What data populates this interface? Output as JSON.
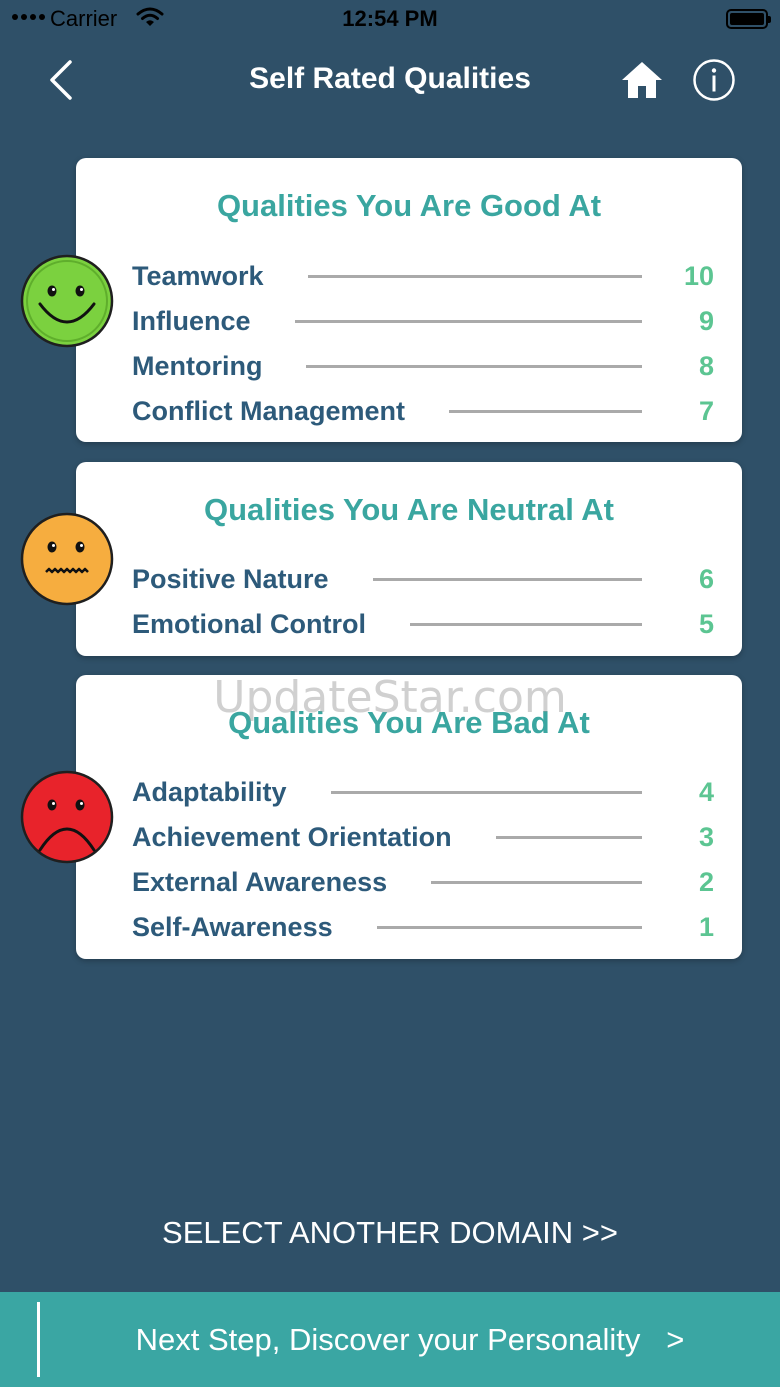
{
  "status_bar": {
    "carrier": "Carrier",
    "time": "12:54 PM"
  },
  "nav": {
    "title": "Self Rated Qualities",
    "back_icon": "chevron-left-icon",
    "home_icon": "home-icon",
    "info_icon": "info-icon"
  },
  "sections": [
    {
      "title": "Qualities You Are Good At",
      "face": "happy-face-icon",
      "face_color": "#7bd13f",
      "items": [
        {
          "label": "Teamwork",
          "score": "10"
        },
        {
          "label": "Influence",
          "score": "9"
        },
        {
          "label": "Mentoring",
          "score": "8"
        },
        {
          "label": "Conflict Management",
          "score": "7"
        }
      ]
    },
    {
      "title": "Qualities You Are Neutral At",
      "face": "neutral-face-icon",
      "face_color": "#f6ad3f",
      "items": [
        {
          "label": "Positive Nature",
          "score": "6"
        },
        {
          "label": "Emotional Control",
          "score": "5"
        }
      ]
    },
    {
      "title": "Qualities You Are Bad At",
      "face": "sad-face-icon",
      "face_color": "#e8232b",
      "items": [
        {
          "label": "Adaptability",
          "score": "4"
        },
        {
          "label": "Achievement Orientation",
          "score": "3"
        },
        {
          "label": "External Awareness",
          "score": "2"
        },
        {
          "label": "Self-Awareness",
          "score": "1"
        }
      ]
    }
  ],
  "watermark": "UpdateStar.com",
  "select_domain": "SELECT ANOTHER DOMAIN >>",
  "footer": {
    "label": "Next Step, Discover your Personality",
    "arrow": ">"
  },
  "colors": {
    "background": "#2f5068",
    "accent_teal": "#3aa6a0",
    "score_green": "#5cc592",
    "label_blue": "#2d5a7a"
  }
}
